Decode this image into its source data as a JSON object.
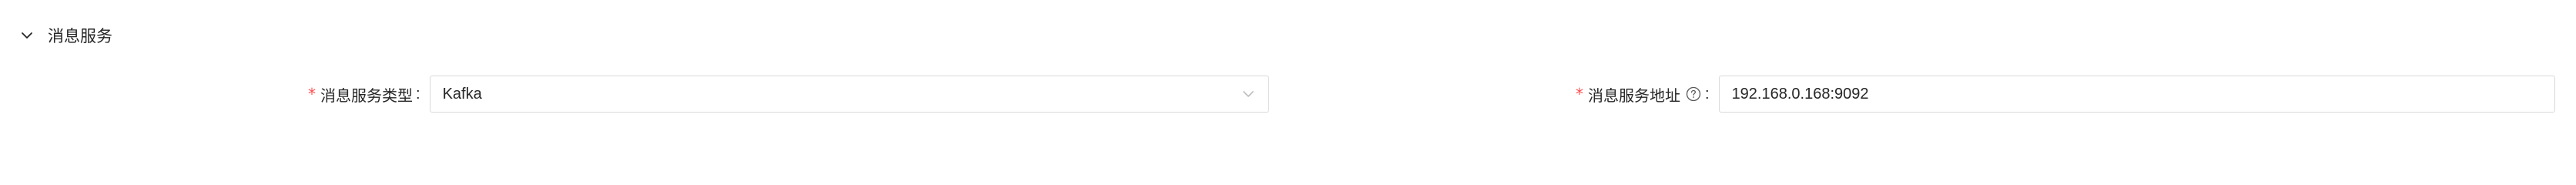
{
  "section": {
    "title": "消息服务",
    "collapse_icon": "chevron-down-icon"
  },
  "fields": {
    "mq_type": {
      "label": "消息服务类型",
      "required_mark": "*",
      "colon": ":",
      "value": "Kafka",
      "arrow_icon": "chevron-down-icon"
    },
    "mq_address": {
      "label": "消息服务地址",
      "required_mark": "*",
      "colon": ":",
      "help_icon": "question-circle-icon",
      "value": "192.168.0.168:9092"
    }
  },
  "colors": {
    "required": "#ff4d4f",
    "border": "#d9d9d9",
    "text": "#262626"
  }
}
